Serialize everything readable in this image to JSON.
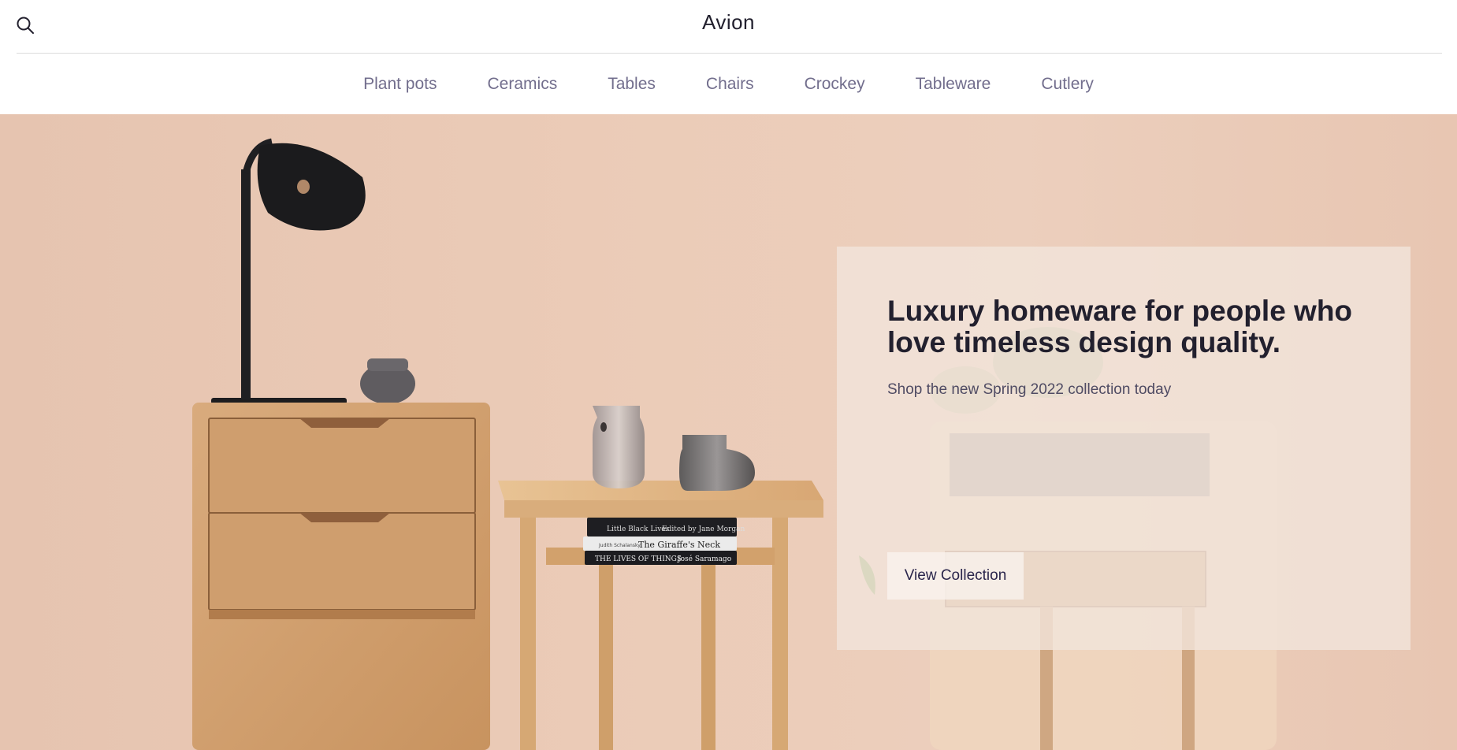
{
  "header": {
    "brand": "Avion",
    "search_icon": "search-icon"
  },
  "nav": {
    "items": [
      {
        "label": "Plant pots"
      },
      {
        "label": "Ceramics"
      },
      {
        "label": "Tables"
      },
      {
        "label": "Chairs"
      },
      {
        "label": "Crockey"
      },
      {
        "label": "Tableware"
      },
      {
        "label": "Cutlery"
      }
    ]
  },
  "hero": {
    "headline": "Luxury homeware for people who love timeless design quality.",
    "subtext": "Shop the new Spring 2022 collection today",
    "cta_label": "View Collection",
    "books": {
      "top": "Little Black Lives",
      "top_right": "Edited by Jane Morgan",
      "middle_author": "Judith Schalansky",
      "middle": "The Giraffe's Neck",
      "bottom": "THE LIVES OF THINGS",
      "bottom_author": "José Saramago"
    }
  },
  "colors": {
    "brand_text": "#22202e",
    "nav_text": "#726e8d",
    "hero_bg": "#ebcbb7",
    "panel_bg": "#f2e4da"
  }
}
